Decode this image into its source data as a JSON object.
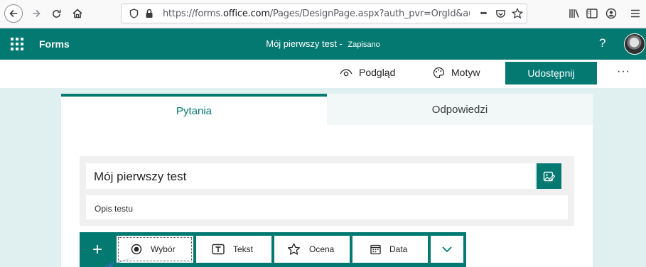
{
  "browser": {
    "url_scheme_prefix": "https://forms.",
    "url_host": "office.com",
    "url_path": "/Pages/DesignPage.aspx?auth_pvr=OrgId&auth_upn=r.fi",
    "overflow_glyph": "•••"
  },
  "header": {
    "app_name": "Forms",
    "form_title": "Mój pierwszy test",
    "separator": " - ",
    "save_status": "Zapisano",
    "help_glyph": "?"
  },
  "commands": {
    "preview": "Podgląd",
    "theme": "Motyw",
    "share": "Udostępnij",
    "more": "···"
  },
  "tabs": {
    "questions": "Pytania",
    "responses": "Odpowiedzi"
  },
  "form": {
    "title": "Mój pierwszy test",
    "description": "Opis testu"
  },
  "question_types": {
    "add": "+",
    "choice": "Wybór",
    "text": "Tekst",
    "rating": "Ocena",
    "date": "Data"
  },
  "colors": {
    "brand": "#037972",
    "canvas": "#e0efef"
  }
}
